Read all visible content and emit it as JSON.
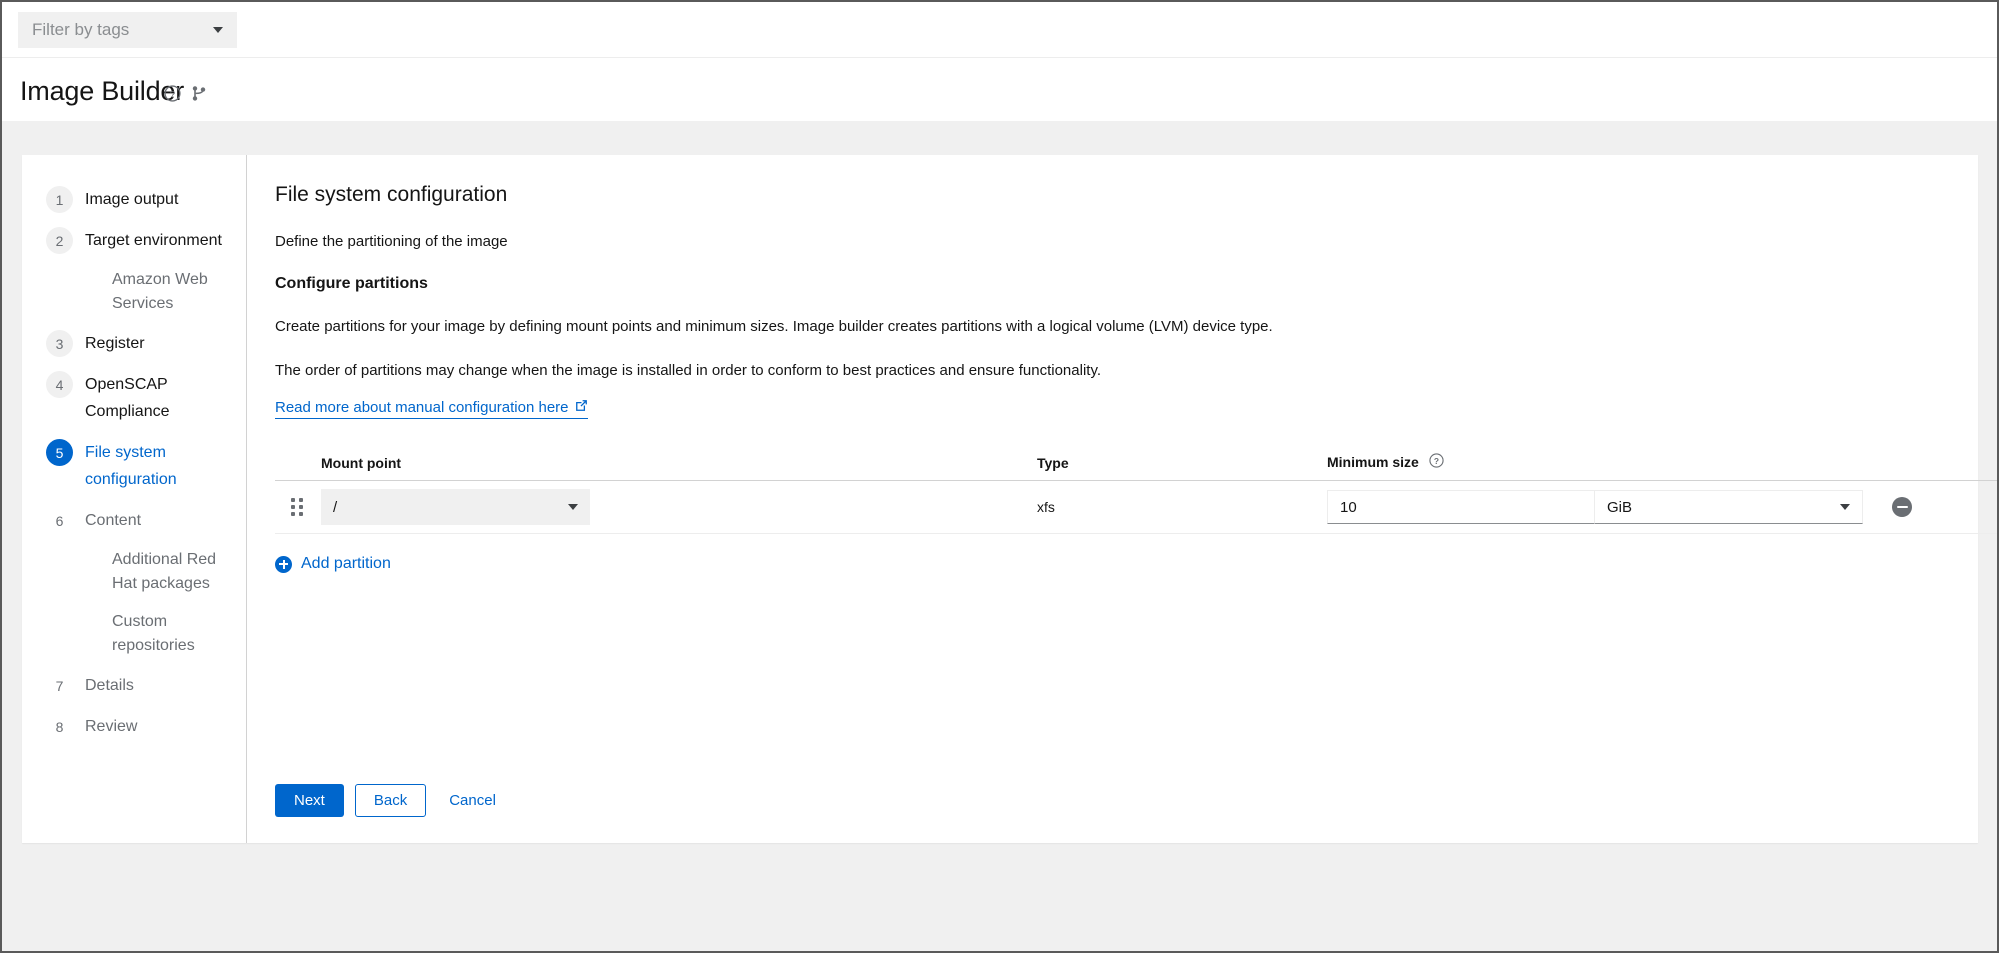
{
  "topbar": {
    "tag_filter_label": "Filter by tags",
    "caret_icon": "chevron-down-icon"
  },
  "header": {
    "title": "Image Builder",
    "help_icon": "question-circle-icon",
    "branch_icon": "code-branch-icon"
  },
  "wizard": {
    "nav": [
      {
        "num": "1",
        "label": "Image output",
        "state": "default",
        "sub": false
      },
      {
        "num": "2",
        "label": "Target environment",
        "state": "default",
        "sub": false
      },
      {
        "num": "",
        "label": "Amazon Web Services",
        "state": "muted",
        "sub": true
      },
      {
        "num": "3",
        "label": "Register",
        "state": "default",
        "sub": false
      },
      {
        "num": "4",
        "label": "OpenSCAP Compliance",
        "state": "default",
        "sub": false
      },
      {
        "num": "5",
        "label": "File system configuration",
        "state": "active",
        "sub": false
      },
      {
        "num": "6",
        "label": "Content",
        "state": "muted",
        "sub": false
      },
      {
        "num": "",
        "label": "Additional Red Hat packages",
        "state": "muted",
        "sub": true
      },
      {
        "num": "",
        "label": "Custom repositories",
        "state": "muted",
        "sub": true
      },
      {
        "num": "7",
        "label": "Details",
        "state": "muted",
        "sub": false
      },
      {
        "num": "8",
        "label": "Review",
        "state": "muted",
        "sub": false
      }
    ],
    "main": {
      "title": "File system configuration",
      "subtitle": "Define the partitioning of the image",
      "section_title": "Configure partitions",
      "paragraph_1": "Create partitions for your image by defining mount points and minimum sizes. Image builder creates partitions with a logical volume (LVM) device type.",
      "paragraph_2": "The order of partitions may change when the image is installed in order to conform to best practices and ensure functionality.",
      "doc_link": "Read more about manual configuration here",
      "doc_link_icon": "external-link-icon"
    },
    "table": {
      "headers": {
        "mount_point": "Mount point",
        "type": "Type",
        "minimum_size": "Minimum size",
        "minimum_size_help_icon": "question-circle-icon"
      },
      "rows": [
        {
          "drag_handle_icon": "grip-vertical-icon",
          "mount_point": "/",
          "type": "xfs",
          "minimum_size": "10",
          "unit": "GiB",
          "remove_icon": "minus-circle-icon"
        }
      ]
    },
    "add_partition": {
      "label": "Add partition",
      "icon": "plus-circle-icon"
    },
    "footer": {
      "next": "Next",
      "back": "Back",
      "cancel": "Cancel"
    }
  },
  "colors": {
    "accent": "#0066cc",
    "page_bg": "#f0f0f0",
    "text": "#151515",
    "muted_text": "#6a6e73"
  }
}
